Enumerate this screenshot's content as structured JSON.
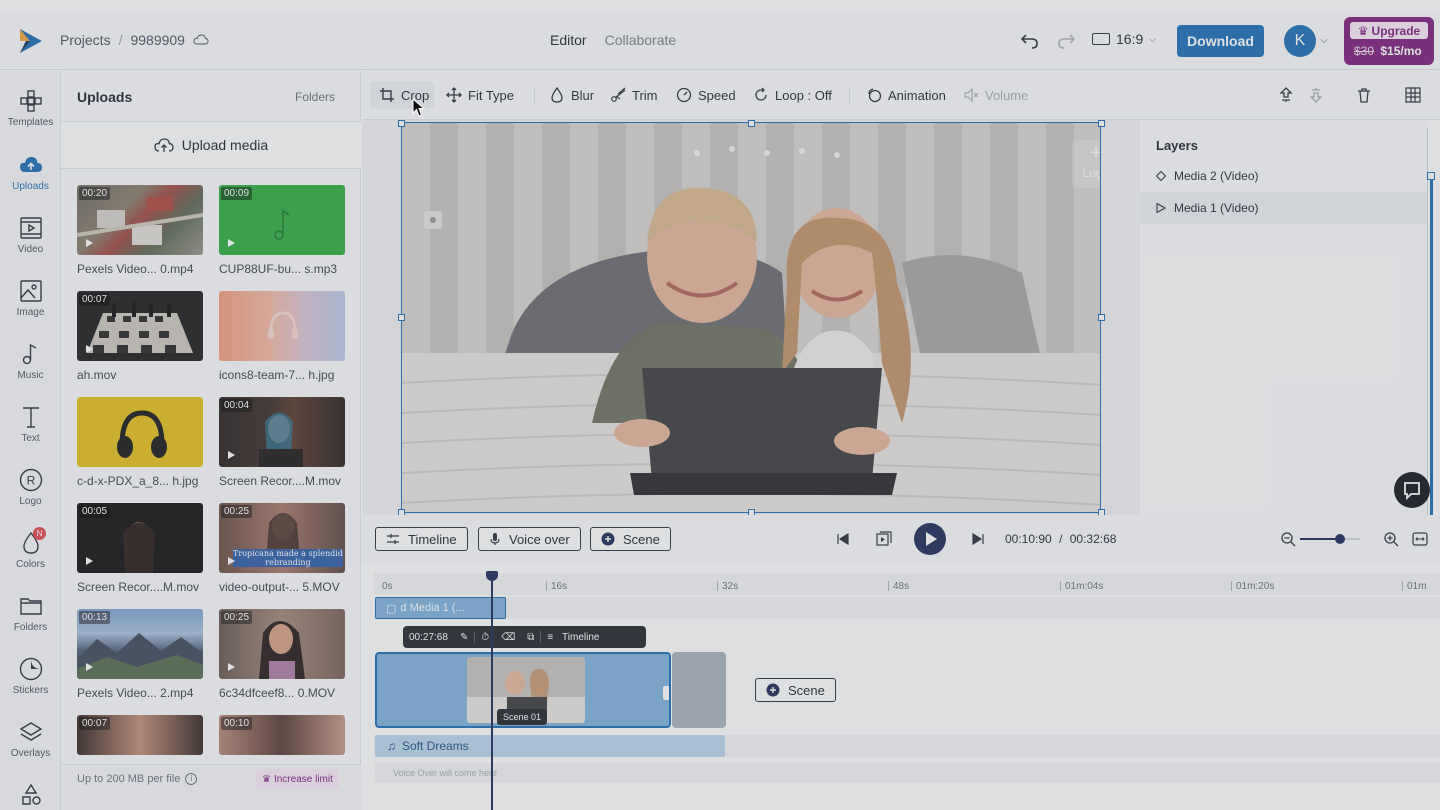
{
  "topbar": {
    "breadcrumb_projects": "Projects",
    "breadcrumb_sep": "/",
    "project_name": "9989909",
    "tab_editor": "Editor",
    "tab_collaborate": "Collaborate",
    "aspect_ratio": "16:9",
    "download_label": "Download",
    "avatar_letter": "K",
    "upgrade_label": "Upgrade",
    "old_price": "$30",
    "new_price": "$15/mo"
  },
  "rail": {
    "templates": "Templates",
    "uploads": "Uploads",
    "video": "Video",
    "image": "Image",
    "music": "Music",
    "text": "Text",
    "logo": "Logo",
    "colors": "Colors",
    "colors_badge": "N",
    "folders": "Folders",
    "stickers": "Stickers",
    "overlays": "Overlays"
  },
  "uploads": {
    "title": "Uploads",
    "folders_link": "Folders",
    "upload_button": "Upload media",
    "files": [
      {
        "name": "Pexels Video... 0.mp4",
        "duration": "00:20",
        "kind": "video"
      },
      {
        "name": "CUP88UF-bu... s.mp3",
        "duration": "00:09",
        "kind": "audio"
      },
      {
        "name": "ah.mov",
        "duration": "00:07",
        "kind": "video"
      },
      {
        "name": "icons8-team-7... h.jpg",
        "duration": "",
        "kind": "image"
      },
      {
        "name": "c-d-x-PDX_a_8... h.jpg",
        "duration": "",
        "kind": "image"
      },
      {
        "name": "Screen Recor....M.mov",
        "duration": "00:04",
        "kind": "video"
      },
      {
        "name": "Screen Recor....M.mov",
        "duration": "00:05",
        "kind": "video"
      },
      {
        "name": "video-output-... 5.MOV",
        "duration": "00:25",
        "kind": "video"
      },
      {
        "name": "Pexels Video... 2.mp4",
        "duration": "00:13",
        "kind": "video"
      },
      {
        "name": "6c34dfceef8... 0.MOV",
        "duration": "00:25",
        "kind": "video"
      },
      {
        "name": "",
        "duration": "00:07",
        "kind": "video"
      },
      {
        "name": "",
        "duration": "00:10",
        "kind": "video"
      }
    ],
    "subtitle_overlay": "Tropicana made a splendid rebranding",
    "footer_text": "Up to 200 MB per file",
    "increase_limit": "Increase limit"
  },
  "toolbar": {
    "crop": "Crop",
    "fit_type": "Fit Type",
    "blur": "Blur",
    "trim": "Trim",
    "speed": "Speed",
    "loop": "Loop : Off",
    "animation": "Animation",
    "volume": "Volume"
  },
  "canvas": {
    "logo_placeholder": "Logo"
  },
  "layers": {
    "title": "Layers",
    "items": [
      {
        "label": "Media 2 (Video)",
        "selected": false
      },
      {
        "label": "Media 1 (Video)",
        "selected": true
      }
    ]
  },
  "controls": {
    "timeline_btn": "Timeline",
    "voiceover_btn": "Voice over",
    "scene_btn": "Scene",
    "current_time": "00:10:90",
    "time_sep": "/",
    "total_time": "00:32:68",
    "zoom_level": 0.67
  },
  "timeline": {
    "ruler": [
      "0s",
      "16s",
      "32s",
      "48s",
      "01m:04s",
      "01m:20s",
      "01m"
    ],
    "media_clip_label": "d Media 1 (...",
    "clip_duration": "00:27:68",
    "clip_timeline_btn": "Timeline",
    "scene_label": "Scene 01",
    "scene_add": "Scene",
    "audio_label": "Soft Dreams",
    "voiceover_placeholder": "Voice Over will come here"
  },
  "colors": {
    "accent": "#1d6fb8",
    "dark": "#1f2c5c",
    "upgrade": "#7e1f7c"
  }
}
